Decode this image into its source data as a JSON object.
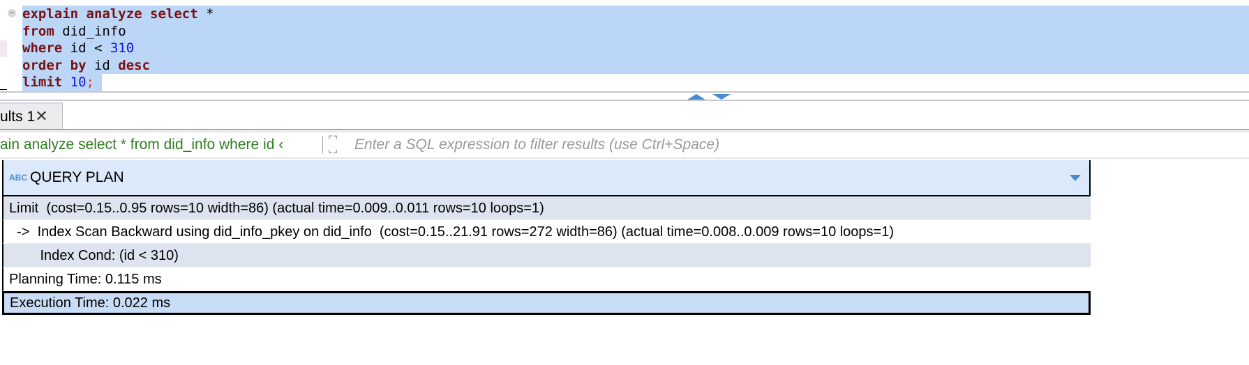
{
  "editor": {
    "lines": [
      [
        {
          "t": "explain analyze select",
          "c": "kw"
        },
        {
          "t": " *",
          "c": "txt"
        }
      ],
      [
        {
          "t": "from",
          "c": "kw"
        },
        {
          "t": " did_info",
          "c": "txt"
        }
      ],
      [
        {
          "t": "where",
          "c": "kw"
        },
        {
          "t": " id < ",
          "c": "txt"
        },
        {
          "t": "310",
          "c": "num"
        }
      ],
      [
        {
          "t": "order by",
          "c": "kw"
        },
        {
          "t": " id ",
          "c": "txt"
        },
        {
          "t": "desc",
          "c": "kw"
        }
      ],
      [
        {
          "t": "limit",
          "c": "kw"
        },
        {
          "t": " ",
          "c": "txt"
        },
        {
          "t": "10",
          "c": "num"
        },
        {
          "t": ";",
          "c": "semi"
        }
      ]
    ]
  },
  "tabs": [
    {
      "label": "ults 1",
      "active": true
    }
  ],
  "filter": {
    "query": "ain analyze select * from did_info where id ‹",
    "placeholder": "Enter a SQL expression to filter results (use Ctrl+Space)"
  },
  "grid": {
    "column": "QUERY PLAN",
    "column_type": "ABC",
    "rows": [
      "Limit  (cost=0.15..0.95 rows=10 width=86) (actual time=0.009..0.011 rows=10 loops=1)",
      "  ->  Index Scan Backward using did_info_pkey on did_info  (cost=0.15..21.91 rows=272 width=86) (actual time=0.008..0.009 rows=10 loops=1)",
      "        Index Cond: (id < 310)",
      "Planning Time: 0.115 ms",
      "Execution Time: 0.022 ms"
    ],
    "selected_row": 4
  },
  "colors": {
    "selection": "#bcd6f8",
    "keyword": "#7a1010",
    "number": "#1414e0",
    "filter_text": "#2e7d1e",
    "accent": "#4a8ad0"
  }
}
